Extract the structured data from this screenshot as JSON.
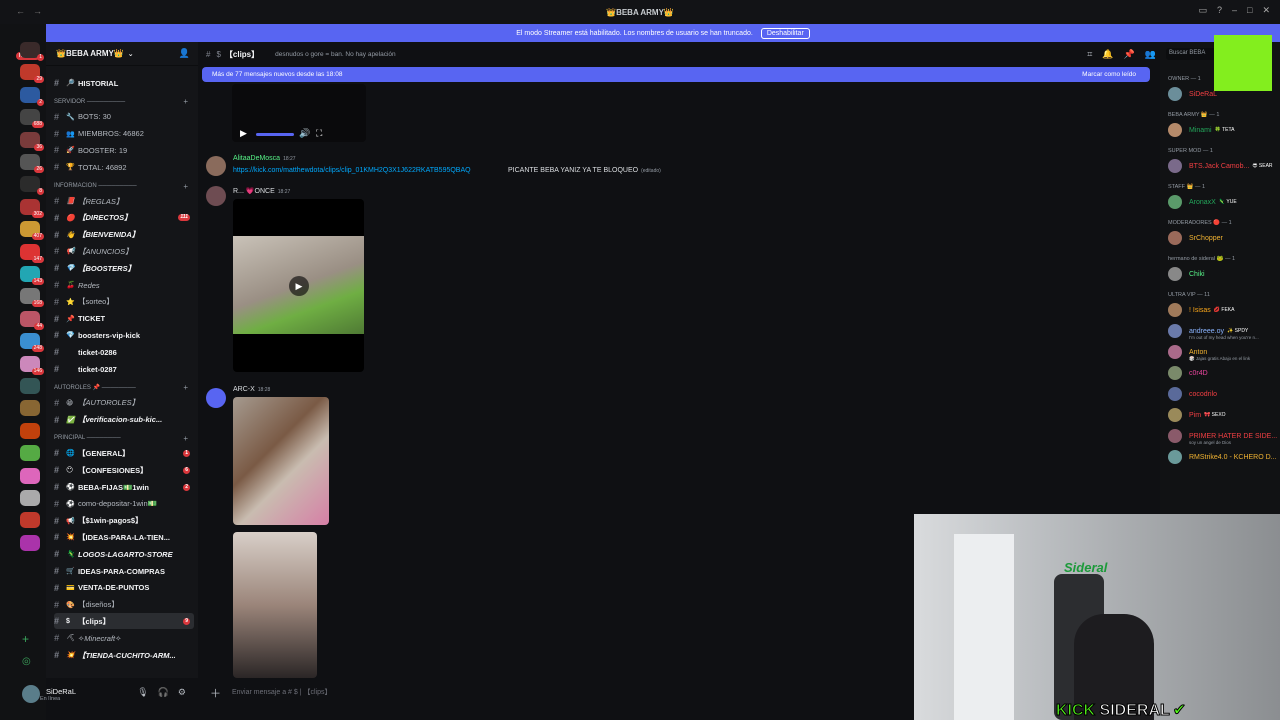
{
  "window": {
    "title": "👑BEBA ARMY👑"
  },
  "streamer_bar": {
    "text": "El modo Streamer está habilitado. Los nombres de usuario se han truncado.",
    "button": "Deshabilitar"
  },
  "servers": {
    "new_label": "NUEVO",
    "badges": [
      "1",
      "29",
      "2",
      "688",
      "36",
      "26",
      "8",
      "302",
      "407",
      "147",
      "143",
      "168",
      "44",
      "248",
      "146"
    ]
  },
  "server": {
    "name": "👑BEBA ARMY👑"
  },
  "channels": [
    {
      "kind": "ch",
      "emo": "🔎",
      "label": "HISTORIAL",
      "bold": true
    },
    {
      "kind": "cat",
      "label": "SERVIDOR ─────────"
    },
    {
      "kind": "ch",
      "emo": "🔧",
      "label": "BOTS: 30"
    },
    {
      "kind": "ch",
      "emo": "👥",
      "label": "MIEMBROS: 46862"
    },
    {
      "kind": "ch",
      "emo": "🚀",
      "label": "BOOSTER: 19"
    },
    {
      "kind": "ch",
      "emo": "🏆",
      "label": "TOTAL: 46892"
    },
    {
      "kind": "cat",
      "label": "INFORMACION ─────────"
    },
    {
      "kind": "ch",
      "emo": "📕",
      "label": "【REGLAS】",
      "italic": true
    },
    {
      "kind": "ch",
      "emo": "🔴",
      "label": "【DIRECTOS】",
      "bold": true,
      "italic": true,
      "count": "111"
    },
    {
      "kind": "ch",
      "emo": "👋",
      "label": "【BIENVENIDA】",
      "bold": true,
      "italic": true
    },
    {
      "kind": "ch",
      "emo": "📢",
      "label": "【ANUNCIOS】",
      "italic": true
    },
    {
      "kind": "ch",
      "emo": "💎",
      "label": "【BOOSTERS】",
      "bold": true,
      "italic": true
    },
    {
      "kind": "ch",
      "emo": "🍒",
      "label": "Redes",
      "italic": true
    },
    {
      "kind": "ch",
      "emo": "⭐",
      "label": "【sorteo】"
    },
    {
      "kind": "ch",
      "emo": "📌",
      "label": "TICKET",
      "bold": true
    },
    {
      "kind": "ch",
      "emo": "💎",
      "label": "boosters-vip-kick",
      "bold": true
    },
    {
      "kind": "ch",
      "emo": "",
      "label": "ticket-0286",
      "bold": true
    },
    {
      "kind": "ch",
      "emo": "",
      "label": "ticket-0287",
      "bold": true
    },
    {
      "kind": "cat",
      "label": "AUTOROLES 📌 ────────"
    },
    {
      "kind": "ch",
      "emo": "😁",
      "label": "【AUTOROLES】",
      "italic": true
    },
    {
      "kind": "ch",
      "emo": "✅",
      "label": "【verificacion-sub-kic...",
      "bold": true,
      "italic": true
    },
    {
      "kind": "cat",
      "label": "PRINCIPAL ────────"
    },
    {
      "kind": "ch",
      "emo": "🌐",
      "label": "【GENERAL】",
      "bold": true,
      "count": "1"
    },
    {
      "kind": "ch",
      "emo": "😶",
      "label": "【CONFESIONES】",
      "bold": true,
      "count": "6"
    },
    {
      "kind": "ch",
      "emo": "⚽",
      "label": "BEBA-FIJAS💵1win",
      "bold": true,
      "count": "2"
    },
    {
      "kind": "ch",
      "emo": "⚽",
      "label": "como-depositar-1win💵"
    },
    {
      "kind": "ch",
      "emo": "📢",
      "label": "【$1win-pagos$】",
      "bold": true
    },
    {
      "kind": "ch",
      "emo": "💥",
      "label": "【IDEAS-PARA-LA-TIEN...",
      "bold": true
    },
    {
      "kind": "ch",
      "emo": "🦎",
      "label": "LOGOS-LAGARTO-STORE",
      "bold": true,
      "italic": true
    },
    {
      "kind": "ch",
      "emo": "🛒",
      "label": "IDEAS-PARA-COMPRAS",
      "bold": true
    },
    {
      "kind": "ch",
      "emo": "💳",
      "label": "VENTA-DE-PUNTOS",
      "bold": true
    },
    {
      "kind": "ch",
      "emo": "🎨",
      "label": "【diseños】"
    },
    {
      "kind": "ch",
      "emo": "$",
      "label": "【clips】",
      "bold": true,
      "selected": true,
      "count": "9"
    },
    {
      "kind": "ch",
      "emo": "⛏",
      "label": "✧Minecraft✧",
      "italic": true
    },
    {
      "kind": "ch",
      "emo": "💥",
      "label": "【TIENDA-CUCHITO-ARM...",
      "bold": true,
      "italic": true
    }
  ],
  "user": {
    "name": "SiDeRaL",
    "status": "En línea"
  },
  "channel_header": {
    "name": "【clips】",
    "topic": "desnudos o gore = ban. No hay apelación"
  },
  "new_messages": {
    "text": "Más de 77 mensajes nuevos desde las 18:08",
    "mark": "Marcar como leído"
  },
  "messages": {
    "m1": {
      "author": "AlitaaDeMosca",
      "time": "18:27",
      "link": "https://kick.com/matthewdota/clips/clip_01KMH2Q3X1J622RKATB595QBAQ",
      "text": "PICANTE BEBA YANIZ YA TE BLOQUEO",
      "edited": "(editado)"
    },
    "m2": {
      "author": "R... 💗ONCE",
      "time": "18:27"
    },
    "m3": {
      "author": "ARC-X",
      "time": "18:28"
    }
  },
  "composer": {
    "placeholder": "Enviar mensaje a # $ | 【clips】"
  },
  "members": {
    "search": "Buscar BEBA",
    "groups": [
      {
        "role": "OWNER — 1",
        "people": [
          {
            "name": "SiDeRaL",
            "color": "#f23f43"
          }
        ]
      },
      {
        "role": "BEBA ARMY 👑 — 1",
        "people": [
          {
            "name": "Minami",
            "color": "#23a55a",
            "tag": "🍀 TETA"
          }
        ]
      },
      {
        "role": "SUPER MOD — 1",
        "people": [
          {
            "name": "BTS.Jack Camob...",
            "color": "#f23f43",
            "tag": "😎 SEAR"
          }
        ]
      },
      {
        "role": "STAFF 👑 — 1",
        "people": [
          {
            "name": "AronaxX",
            "color": "#23a55a",
            "tag": "🦎 YUE"
          }
        ]
      },
      {
        "role": "MODERADORES 🔴 — 1",
        "people": [
          {
            "name": "SrChopper",
            "color": "#f0b232"
          }
        ]
      },
      {
        "role": "hermano de sideral 🐸 — 1",
        "people": [
          {
            "name": "Chiki",
            "color": "#57f287"
          }
        ]
      },
      {
        "role": "ULTRA VIP — 11",
        "people": [
          {
            "name": "! Isisas",
            "color": "#faa61a",
            "tag": "💋 FEKA"
          },
          {
            "name": "andreee.oy",
            "color": "#8ab4ff",
            "tag": "✨ SPDY",
            "sub": "I'm out of my head when you're n..."
          },
          {
            "name": "Anton",
            "color": "#f0b232",
            "sub": "🎲 Jajas gratis Abajo en el link"
          },
          {
            "name": "c0r4D",
            "color": "#eb459e"
          },
          {
            "name": "cocodrilo",
            "color": "#f23f43"
          },
          {
            "name": "Pim",
            "color": "#f23f43",
            "tag": "🎀 SEXO"
          },
          {
            "name": "PRIMER HATER DE SIDE...",
            "color": "#f23f43",
            "sub": "soy un angel de Dios"
          },
          {
            "name": "RMStrike4.0 - KCHERO D...",
            "color": "#f0b232"
          }
        ]
      }
    ]
  },
  "overlay": {
    "brand_k": "KICK",
    "brand_rest": " SIDERAL",
    "check": "✔"
  },
  "colors": {
    "accent": "#5865f2",
    "kick_green": "#53fc18",
    "overlay_square": "#83ee1e"
  }
}
